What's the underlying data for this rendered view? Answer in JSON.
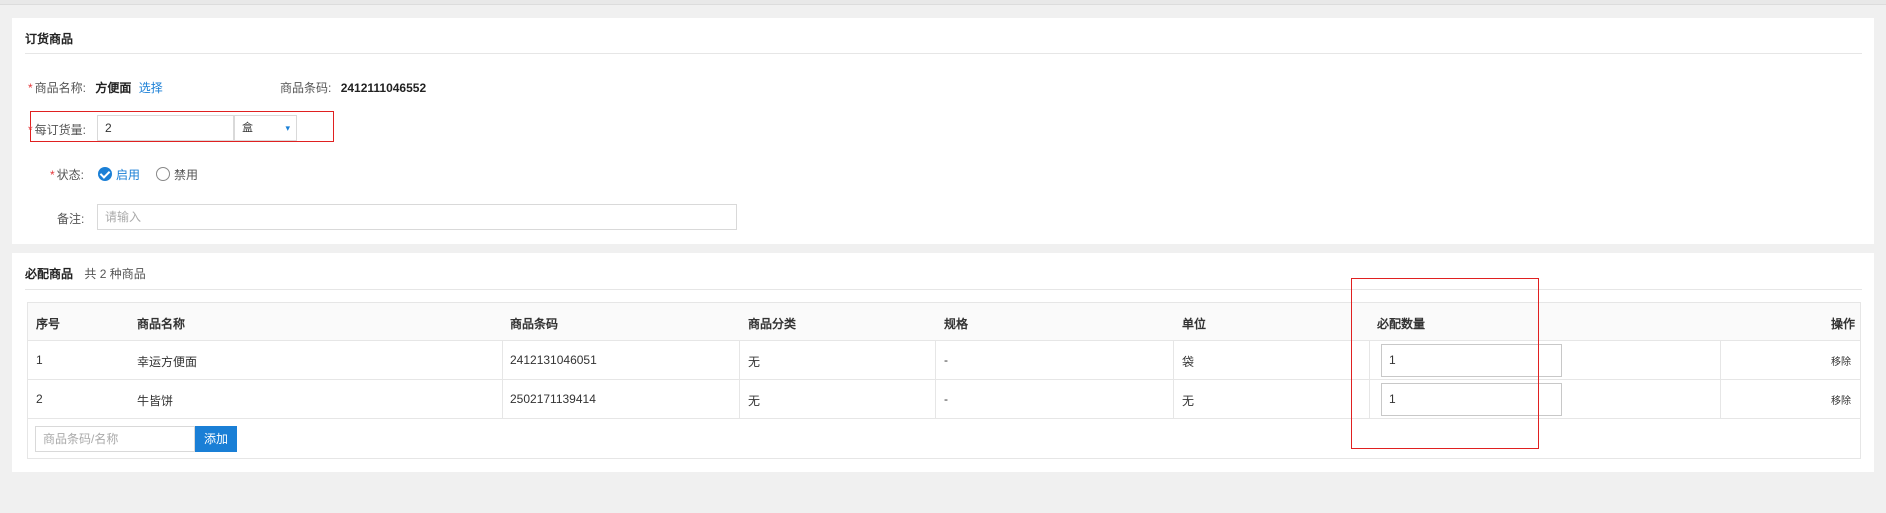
{
  "order_section": {
    "title": "订货商品",
    "product_name_label": "商品名称:",
    "product_name_value": "方便面",
    "select_link": "选择",
    "barcode_label": "商品条码:",
    "barcode_value": "2412111046552",
    "qty_label": "每订货量:",
    "qty_value": "2",
    "unit_value": "盒",
    "status_label": "状态:",
    "status_enabled": "启用",
    "status_disabled": "禁用",
    "remark_label": "备注:",
    "remark_placeholder": "请输入"
  },
  "required_section": {
    "title": "必配商品",
    "count_text": "共 2 种商品",
    "columns": [
      "序号",
      "商品名称",
      "商品条码",
      "商品分类",
      "规格",
      "单位",
      "必配数量",
      "操作"
    ],
    "rows": [
      {
        "index": "1",
        "name": "幸运方便面",
        "barcode": "2412131046051",
        "category": "无",
        "spec": "-",
        "unit": "袋",
        "qty": "1",
        "action": "移除"
      },
      {
        "index": "2",
        "name": "牛皆饼",
        "barcode": "2502171139414",
        "category": "无",
        "spec": "-",
        "unit": "无",
        "qty": "1",
        "action": "移除"
      }
    ],
    "search_placeholder": "商品条码/名称",
    "add_button": "添加"
  },
  "colors": {
    "accent": "#1a7fd6",
    "required": "#e4393c",
    "highlight_box": "#e02020"
  }
}
